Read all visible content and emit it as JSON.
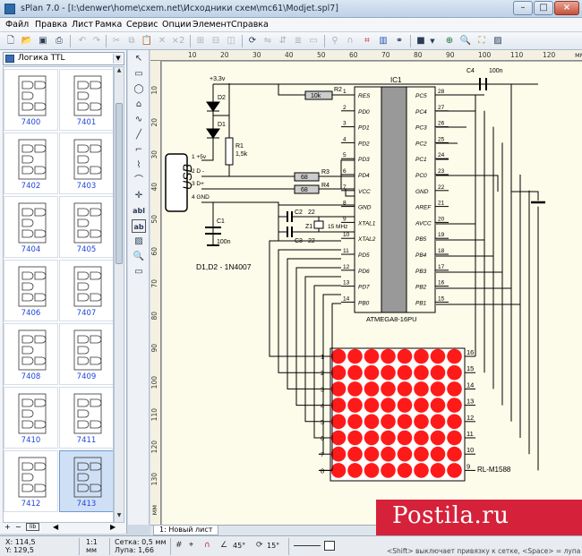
{
  "window": {
    "title": "sPlan 7.0 - [I:\\denwer\\home\\cxem.net\\Исходники схем\\mc61\\Modjet.spl7]"
  },
  "menu": [
    "Файл",
    "Правка",
    "Лист",
    "Рамка",
    "Сервис",
    "Опции",
    "Элемент",
    "Справка"
  ],
  "toolbar": {
    "zoom_label": "×2"
  },
  "library": {
    "selected": "Логика TTL",
    "tiles": [
      "7400",
      "7401",
      "7402",
      "7403",
      "7404",
      "7405",
      "7406",
      "7407",
      "7408",
      "7409",
      "7410",
      "7411",
      "7412",
      "7413"
    ],
    "selected_tile": "7413"
  },
  "rulers": {
    "top": [
      "10",
      "20",
      "30",
      "40",
      "50",
      "60",
      "70",
      "80",
      "90",
      "100",
      "110",
      "120",
      "мм"
    ],
    "left": [
      "10",
      "20",
      "30",
      "40",
      "50",
      "60",
      "70",
      "80",
      "90",
      "100",
      "110",
      "120",
      "130",
      "мм"
    ]
  },
  "schematic": {
    "ic_name": "IC1",
    "ic_part": "ATMEGA8-16PU",
    "left_pins": [
      {
        "num": "1",
        "name": "RES"
      },
      {
        "num": "2",
        "name": "PD0"
      },
      {
        "num": "3",
        "name": "PD1"
      },
      {
        "num": "4",
        "name": "PD2"
      },
      {
        "num": "5",
        "name": "PD3"
      },
      {
        "num": "6",
        "name": "PD4"
      },
      {
        "num": "7",
        "name": "VCC"
      },
      {
        "num": "8",
        "name": "GND"
      },
      {
        "num": "9",
        "name": "XTAL1"
      },
      {
        "num": "10",
        "name": "XTAL2"
      },
      {
        "num": "11",
        "name": "PD5"
      },
      {
        "num": "12",
        "name": "PD6"
      },
      {
        "num": "13",
        "name": "PD7"
      },
      {
        "num": "14",
        "name": "PB0"
      }
    ],
    "right_pins": [
      {
        "num": "28",
        "name": "PC5"
      },
      {
        "num": "27",
        "name": "PC4"
      },
      {
        "num": "26",
        "name": "PC3"
      },
      {
        "num": "25",
        "name": "PC2"
      },
      {
        "num": "24",
        "name": "PC1"
      },
      {
        "num": "23",
        "name": "PC0"
      },
      {
        "num": "22",
        "name": "GND"
      },
      {
        "num": "21",
        "name": "AREF"
      },
      {
        "num": "20",
        "name": "AVCC"
      },
      {
        "num": "19",
        "name": "PB5"
      },
      {
        "num": "18",
        "name": "PB4"
      },
      {
        "num": "17",
        "name": "PB3"
      },
      {
        "num": "16",
        "name": "PB2"
      },
      {
        "num": "15",
        "name": "PB1"
      }
    ],
    "labels": {
      "vcc": "+3,3v",
      "d2": "D2",
      "d1": "D1",
      "r1": "R1",
      "r1_val": "1,5k",
      "r2": "R2",
      "r2_val": "10k",
      "r3": "R3",
      "r3_val": "68",
      "r4": "R4",
      "r4_val": "68",
      "usb": "USB",
      "usb_p1": "1 +5v",
      "usb_p2": "2 D -",
      "usb_p3": "3 D+",
      "usb_p4": "4 GND",
      "c1": "C1",
      "c1_val": "100n",
      "c2": "C2",
      "c2_val": "22",
      "c3": "C3",
      "c3_val": "22",
      "z1": "Z1",
      "z1_val": "15 MHz",
      "c4": "C4",
      "c4_val": "100n",
      "diodes_note": "D1,D2 - 1N4007",
      "matrix": "RL-M1588"
    },
    "matrix_left": [
      "1",
      "2",
      "3",
      "4",
      "5",
      "6",
      "7",
      "8"
    ],
    "matrix_right": [
      "16",
      "15",
      "14",
      "13",
      "12",
      "11",
      "10",
      "9"
    ],
    "matrix_color": "#ff1a1a"
  },
  "tabs": [
    "1: Новый лист"
  ],
  "status": {
    "x": "X: 114,5",
    "y": "Y: 129,5",
    "scale": "1:1",
    "unit": "мм",
    "grid": "Сетка: 0,5 мм",
    "zoom": "Лупа: 1,66",
    "angle1": "45°",
    "angle2": "15°",
    "hint": "<Shift> выключает привязку к сетке, <Space> = лупа"
  },
  "watermark": "Postila.ru",
  "colors": {
    "accent": "#d6213a",
    "sheet": "#fdfbea",
    "pin_label": "#1f46d8"
  }
}
